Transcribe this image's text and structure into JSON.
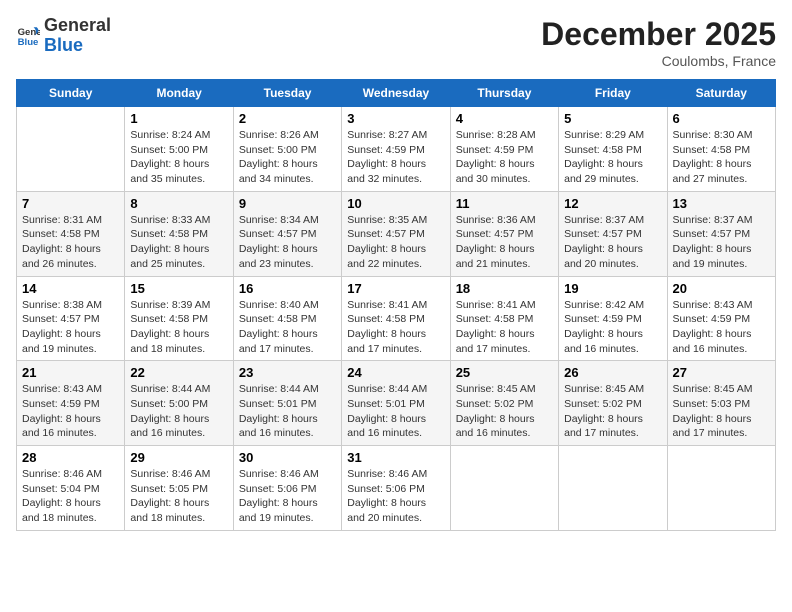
{
  "logo": {
    "line1": "General",
    "line2": "Blue"
  },
  "title": "December 2025",
  "subtitle": "Coulombs, France",
  "headers": [
    "Sunday",
    "Monday",
    "Tuesday",
    "Wednesday",
    "Thursday",
    "Friday",
    "Saturday"
  ],
  "weeks": [
    [
      {
        "day": "",
        "content": ""
      },
      {
        "day": "1",
        "content": "Sunrise: 8:24 AM\nSunset: 5:00 PM\nDaylight: 8 hours\nand 35 minutes."
      },
      {
        "day": "2",
        "content": "Sunrise: 8:26 AM\nSunset: 5:00 PM\nDaylight: 8 hours\nand 34 minutes."
      },
      {
        "day": "3",
        "content": "Sunrise: 8:27 AM\nSunset: 4:59 PM\nDaylight: 8 hours\nand 32 minutes."
      },
      {
        "day": "4",
        "content": "Sunrise: 8:28 AM\nSunset: 4:59 PM\nDaylight: 8 hours\nand 30 minutes."
      },
      {
        "day": "5",
        "content": "Sunrise: 8:29 AM\nSunset: 4:58 PM\nDaylight: 8 hours\nand 29 minutes."
      },
      {
        "day": "6",
        "content": "Sunrise: 8:30 AM\nSunset: 4:58 PM\nDaylight: 8 hours\nand 27 minutes."
      }
    ],
    [
      {
        "day": "7",
        "content": "Sunrise: 8:31 AM\nSunset: 4:58 PM\nDaylight: 8 hours\nand 26 minutes."
      },
      {
        "day": "8",
        "content": "Sunrise: 8:33 AM\nSunset: 4:58 PM\nDaylight: 8 hours\nand 25 minutes."
      },
      {
        "day": "9",
        "content": "Sunrise: 8:34 AM\nSunset: 4:57 PM\nDaylight: 8 hours\nand 23 minutes."
      },
      {
        "day": "10",
        "content": "Sunrise: 8:35 AM\nSunset: 4:57 PM\nDaylight: 8 hours\nand 22 minutes."
      },
      {
        "day": "11",
        "content": "Sunrise: 8:36 AM\nSunset: 4:57 PM\nDaylight: 8 hours\nand 21 minutes."
      },
      {
        "day": "12",
        "content": "Sunrise: 8:37 AM\nSunset: 4:57 PM\nDaylight: 8 hours\nand 20 minutes."
      },
      {
        "day": "13",
        "content": "Sunrise: 8:37 AM\nSunset: 4:57 PM\nDaylight: 8 hours\nand 19 minutes."
      }
    ],
    [
      {
        "day": "14",
        "content": "Sunrise: 8:38 AM\nSunset: 4:57 PM\nDaylight: 8 hours\nand 19 minutes."
      },
      {
        "day": "15",
        "content": "Sunrise: 8:39 AM\nSunset: 4:58 PM\nDaylight: 8 hours\nand 18 minutes."
      },
      {
        "day": "16",
        "content": "Sunrise: 8:40 AM\nSunset: 4:58 PM\nDaylight: 8 hours\nand 17 minutes."
      },
      {
        "day": "17",
        "content": "Sunrise: 8:41 AM\nSunset: 4:58 PM\nDaylight: 8 hours\nand 17 minutes."
      },
      {
        "day": "18",
        "content": "Sunrise: 8:41 AM\nSunset: 4:58 PM\nDaylight: 8 hours\nand 17 minutes."
      },
      {
        "day": "19",
        "content": "Sunrise: 8:42 AM\nSunset: 4:59 PM\nDaylight: 8 hours\nand 16 minutes."
      },
      {
        "day": "20",
        "content": "Sunrise: 8:43 AM\nSunset: 4:59 PM\nDaylight: 8 hours\nand 16 minutes."
      }
    ],
    [
      {
        "day": "21",
        "content": "Sunrise: 8:43 AM\nSunset: 4:59 PM\nDaylight: 8 hours\nand 16 minutes."
      },
      {
        "day": "22",
        "content": "Sunrise: 8:44 AM\nSunset: 5:00 PM\nDaylight: 8 hours\nand 16 minutes."
      },
      {
        "day": "23",
        "content": "Sunrise: 8:44 AM\nSunset: 5:01 PM\nDaylight: 8 hours\nand 16 minutes."
      },
      {
        "day": "24",
        "content": "Sunrise: 8:44 AM\nSunset: 5:01 PM\nDaylight: 8 hours\nand 16 minutes."
      },
      {
        "day": "25",
        "content": "Sunrise: 8:45 AM\nSunset: 5:02 PM\nDaylight: 8 hours\nand 16 minutes."
      },
      {
        "day": "26",
        "content": "Sunrise: 8:45 AM\nSunset: 5:02 PM\nDaylight: 8 hours\nand 17 minutes."
      },
      {
        "day": "27",
        "content": "Sunrise: 8:45 AM\nSunset: 5:03 PM\nDaylight: 8 hours\nand 17 minutes."
      }
    ],
    [
      {
        "day": "28",
        "content": "Sunrise: 8:46 AM\nSunset: 5:04 PM\nDaylight: 8 hours\nand 18 minutes."
      },
      {
        "day": "29",
        "content": "Sunrise: 8:46 AM\nSunset: 5:05 PM\nDaylight: 8 hours\nand 18 minutes."
      },
      {
        "day": "30",
        "content": "Sunrise: 8:46 AM\nSunset: 5:06 PM\nDaylight: 8 hours\nand 19 minutes."
      },
      {
        "day": "31",
        "content": "Sunrise: 8:46 AM\nSunset: 5:06 PM\nDaylight: 8 hours\nand 20 minutes."
      },
      {
        "day": "",
        "content": ""
      },
      {
        "day": "",
        "content": ""
      },
      {
        "day": "",
        "content": ""
      }
    ]
  ]
}
